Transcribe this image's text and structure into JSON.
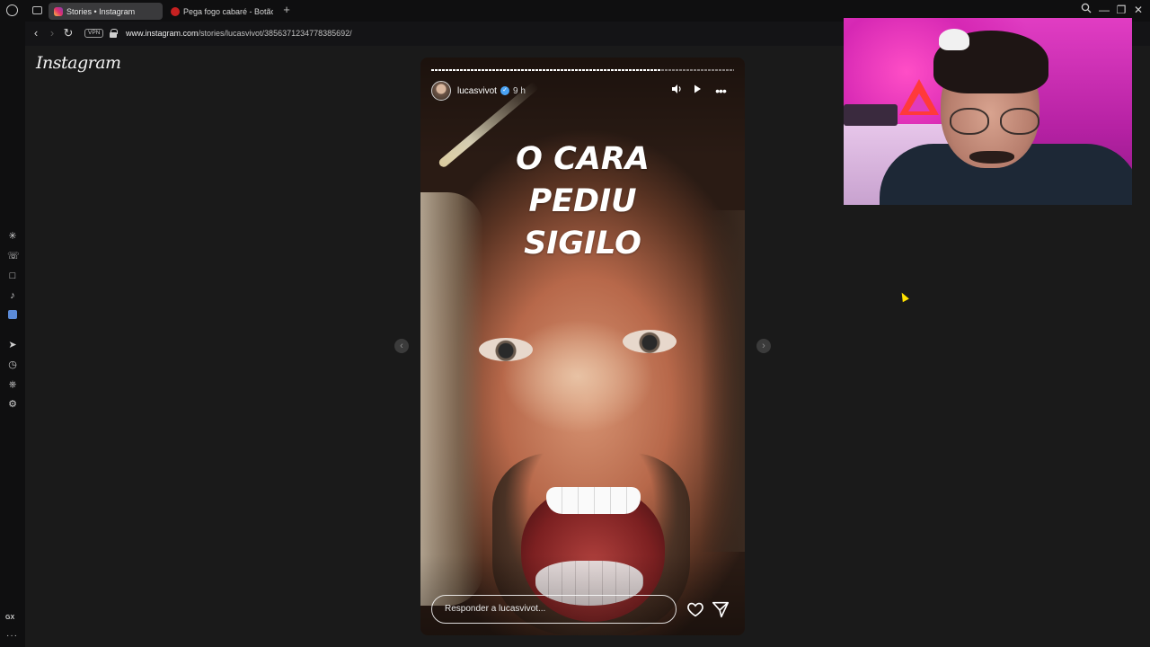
{
  "browser": {
    "tabs": [
      {
        "title": "Stories • Instagram",
        "active": true,
        "favicon": "instagram-icon"
      },
      {
        "title": "Pega fogo cabaré - Botão",
        "active": false,
        "favicon": "youtube-icon"
      }
    ],
    "url_domain": "www.instagram.com",
    "url_path": "/stories/lucasvivot/3856371234778385692/",
    "vpn_label": "VPN",
    "sidebar_gx_label": "GX",
    "sidebar_more_label": "···"
  },
  "page": {
    "logo_text": "Instagram"
  },
  "story": {
    "username": "lucasvivot",
    "verified": true,
    "time_ago": "9 h",
    "text_lines": [
      "O CARA",
      "PEDIU",
      "SIGILO"
    ],
    "progress": 0.76,
    "reply_placeholder": "Responder a lucasvivot...",
    "icons": {
      "mute": "speaker-icon",
      "play": "play-icon",
      "more": "more-icon",
      "like": "heart-icon",
      "share": "send-icon"
    }
  },
  "colors": {
    "background": "#1a1a1a",
    "webcam_bg": "#e13dc3",
    "verified": "#4aa3f5",
    "cursor": "#ffe100"
  }
}
